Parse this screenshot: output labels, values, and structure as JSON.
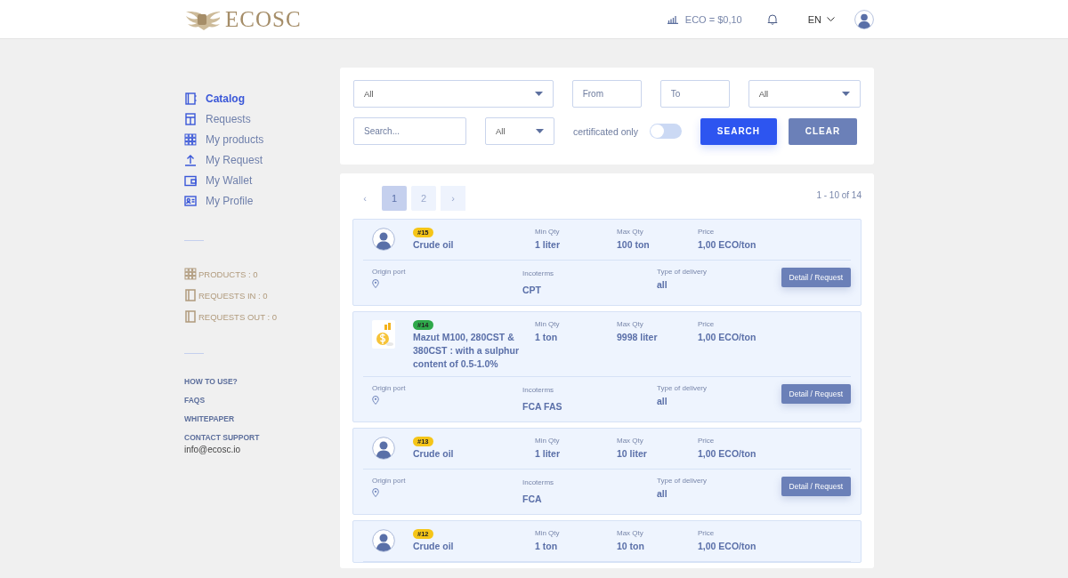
{
  "header": {
    "logo": "ECOSC",
    "rate": "ECO = $0,10",
    "language": "EN"
  },
  "sidebar": {
    "nav": [
      {
        "label": "Catalog",
        "selected": true
      },
      {
        "label": "Requests",
        "selected": false
      },
      {
        "label": "My products",
        "selected": false
      },
      {
        "label": "My Request",
        "selected": false
      },
      {
        "label": "My Wallet",
        "selected": false
      },
      {
        "label": "My Profile",
        "selected": false
      }
    ],
    "stats": [
      "PRODUCTS : 0",
      "REQUESTS IN : 0",
      "REQUESTS OUT : 0"
    ],
    "links": [
      "HOW TO USE?",
      "FAQS",
      "WHITEPAPER",
      "CONTACT SUPPORT"
    ],
    "email": "info@ecosc.io"
  },
  "filters": {
    "category": "All",
    "from_placeholder": "From",
    "to_placeholder": "To",
    "unit": "All",
    "search_placeholder": "Search...",
    "type": "All",
    "certificated_label": "certificated only",
    "certificated_on": false,
    "search_button": "SEARCH",
    "clear_button": "CLEAR"
  },
  "pagination": {
    "prev": "‹",
    "next": "›",
    "pages": [
      {
        "label": "1",
        "selected": true
      },
      {
        "label": "2",
        "selected": false
      }
    ],
    "range": "1 - 10 of 14"
  },
  "products": [
    {
      "kind": "avatar",
      "badge": "#15",
      "color": "#f5c518",
      "title": "Crude oil",
      "specs": [
        {
          "label": "Min Qty",
          "value": "1 liter"
        },
        {
          "label": "Max Qty",
          "value": "100 ton"
        },
        {
          "label": "Price",
          "value": "1,00 ECO/ton"
        }
      ],
      "details": {
        "origin_label": "Origin port",
        "incoterms_label": "Incoterms",
        "incoterms": "CPT",
        "delivery_label": "Type of delivery",
        "delivery": "all",
        "button": "Detail / Request"
      }
    },
    {
      "kind": "product",
      "badge": "#14",
      "color": "#2ea84a",
      "title": "Mazut M100, 280CST & 380CST : with a sulphur content of 0.5-1.0%",
      "specs": [
        {
          "label": "Min Qty",
          "value": "1 ton"
        },
        {
          "label": "Max Qty",
          "value": "9998 liter"
        },
        {
          "label": "Price",
          "value": "1,00 ECO/ton"
        }
      ],
      "details": {
        "origin_label": "Origin port",
        "incoterms_label": "Incoterms",
        "incoterms": "FCA FAS",
        "delivery_label": "Type of delivery",
        "delivery": "all",
        "button": "Detail / Request"
      }
    },
    {
      "kind": "avatar",
      "badge": "#13",
      "color": "#f5c518",
      "title": "Crude oil",
      "specs": [
        {
          "label": "Min Qty",
          "value": "1 liter"
        },
        {
          "label": "Max Qty",
          "value": "10 liter"
        },
        {
          "label": "Price",
          "value": "1,00 ECO/ton"
        }
      ],
      "details": {
        "origin_label": "Origin port",
        "incoterms_label": "Incoterms",
        "incoterms": "FCA",
        "delivery_label": "Type of delivery",
        "delivery": "all",
        "button": "Detail / Request"
      }
    },
    {
      "kind": "avatar",
      "badge": "#12",
      "color": "#f5c518",
      "title": "Crude oil",
      "specs": [
        {
          "label": "Min Qty",
          "value": "1 ton"
        },
        {
          "label": "Max Qty",
          "value": "10 ton"
        },
        {
          "label": "Price",
          "value": "1,00 ECO/ton"
        }
      ]
    }
  ]
}
